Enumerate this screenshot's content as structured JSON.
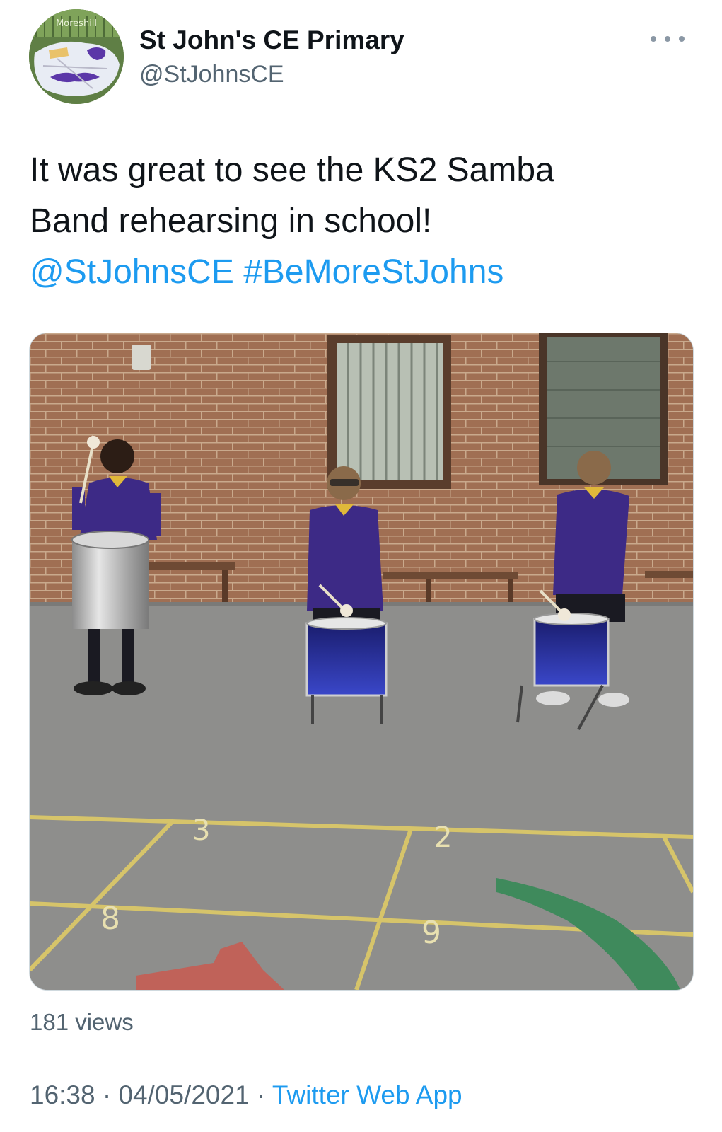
{
  "author": {
    "display_name": "St John's CE Primary",
    "handle": "@StJohnsCE",
    "avatar_icon": "school-logo-avatar",
    "avatar_text": "Moreshill"
  },
  "tweet": {
    "text_line1": "It was great to see the KS2 Samba",
    "text_line2": "Band rehearsing in school!",
    "mention": "@StJohnsCE",
    "hashtag": "#BeMoreStJohns"
  },
  "media": {
    "type": "video",
    "playground_numbers": [
      "3",
      "2",
      "8",
      "9"
    ]
  },
  "stats": {
    "views": "181 views"
  },
  "meta": {
    "time": "16:38",
    "separator": "·",
    "date": "04/05/2021",
    "source": "Twitter Web App"
  },
  "colors": {
    "link": "#1d9bf0",
    "secondary_text": "#536471",
    "uniform_purple": "#3d2a86",
    "brick": "#9a6a50"
  }
}
